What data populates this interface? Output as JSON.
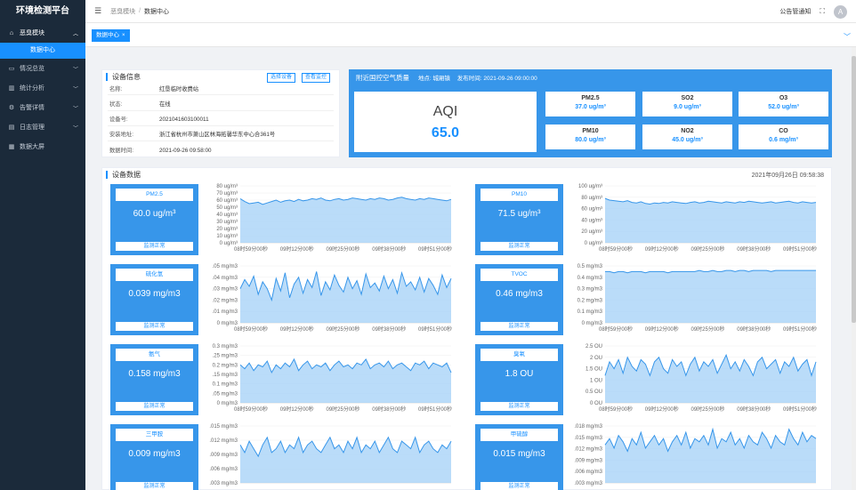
{
  "app": {
    "title": "环境检测平台"
  },
  "sidebar": {
    "items": [
      {
        "label": "恶臭模块",
        "icon": "home-icon",
        "glyph": "⌂",
        "open": true
      },
      {
        "label": "情况总览",
        "icon": "monitor-icon",
        "glyph": "▭"
      },
      {
        "label": "统计分析",
        "icon": "bar-chart-icon",
        "glyph": "▥"
      },
      {
        "label": "告警详情",
        "icon": "bell-icon",
        "glyph": "⚙"
      },
      {
        "label": "日志管理",
        "icon": "document-icon",
        "glyph": "▤"
      },
      {
        "label": "数据大屏",
        "icon": "screen-icon",
        "glyph": "▦"
      }
    ],
    "sub_item": "数据中心"
  },
  "header": {
    "breadcrumb": [
      "恶臭模块",
      "数据中心"
    ],
    "notice": "公告管通知",
    "fullscreen_glyph": "⛶",
    "avatar_glyph": "A"
  },
  "tabs": [
    {
      "label": "数据中心"
    }
  ],
  "device_info": {
    "title": "设备信息",
    "btn_select": "选择设备",
    "btn_monitor": "查看监控",
    "rows": [
      {
        "label": "名称:",
        "value": "红垦临时收费站"
      },
      {
        "label": "状态:",
        "value": "在线"
      },
      {
        "label": "设备号:",
        "value": "2021041603100011"
      },
      {
        "label": "安装地址:",
        "value": "浙江省杭州市萧山区林海拓馨华东中心合361号"
      },
      {
        "label": "数据时间:",
        "value": "2021-09-26 09:58:00"
      }
    ]
  },
  "aqi": {
    "title": "附近国控空气质量",
    "station": "地点: 城厢镇",
    "publish": "发布时间: 2021-09-26 09:00:00",
    "label": "AQI",
    "value": "65.0",
    "pollutants": [
      {
        "name": "PM2.5",
        "value": "37.0 ug/m³"
      },
      {
        "name": "SO2",
        "value": "9.0 ug/m³"
      },
      {
        "name": "O3",
        "value": "52.0 ug/m³"
      },
      {
        "name": "PM10",
        "value": "80.0 ug/m³"
      },
      {
        "name": "NO2",
        "value": "45.0 ug/m³"
      },
      {
        "name": "CO",
        "value": "0.6 mg/m³"
      }
    ]
  },
  "device_data": {
    "title": "设备数据",
    "time": "2021年09月26日 09:58:38"
  },
  "chart_data": [
    {
      "type": "area",
      "name": "PM2.5",
      "reading": "60.0 ug/m³",
      "status": "监测正常",
      "yticks": [
        "80 ug/m³",
        "70 ug/m³",
        "60 ug/m³",
        "50 ug/m³",
        "40 ug/m³",
        "30 ug/m³",
        "20 ug/m³",
        "10 ug/m³",
        "0 ug/m³"
      ],
      "ymax": 80,
      "xticks": [
        "08时59分00秒",
        "09时12分00秒",
        "09时25分00秒",
        "09时38分00秒",
        "09时51分00秒"
      ],
      "values": [
        62,
        58,
        55,
        56,
        57,
        54,
        56,
        58,
        60,
        57,
        59,
        60,
        58,
        61,
        59,
        60,
        62,
        61,
        63,
        60,
        59,
        61,
        62,
        60,
        61,
        63,
        62,
        61,
        60,
        62,
        61,
        63,
        62,
        60,
        61,
        63,
        64,
        62,
        61,
        60,
        62,
        61,
        63,
        62,
        61,
        60,
        59,
        61
      ]
    },
    {
      "type": "area",
      "name": "PM10",
      "reading": "71.5 ug/m³",
      "status": "监测正常",
      "yticks": [
        "100 ug/m³",
        "80 ug/m³",
        "60 ug/m³",
        "40 ug/m³",
        "20 ug/m³",
        "0 ug/m³"
      ],
      "ymax": 100,
      "xticks": [
        "08时59分00秒",
        "09时12分00秒",
        "09时25分00秒",
        "09时38分00秒",
        "09时51分00秒"
      ],
      "values": [
        78,
        75,
        74,
        73,
        72,
        74,
        71,
        70,
        72,
        69,
        68,
        70,
        69,
        71,
        70,
        72,
        71,
        70,
        69,
        71,
        72,
        70,
        71,
        73,
        72,
        71,
        70,
        72,
        71,
        70,
        72,
        71,
        73,
        72,
        71,
        70,
        71,
        72,
        70,
        71,
        72,
        73,
        71,
        70,
        72,
        71,
        70,
        71
      ]
    },
    {
      "type": "area",
      "name": "硫化氢",
      "reading": "0.039 mg/m3",
      "status": "监测正常",
      "yticks": [
        ".05 mg/m3",
        ".04 mg/m3",
        ".03 mg/m3",
        ".02 mg/m3",
        ".01 mg/m3",
        "0 mg/m3"
      ],
      "ymax": 0.05,
      "xticks": [
        "08时59分00秒",
        "09时12分00秒",
        "09时25分00秒",
        "09时38分00秒",
        "09时51分00秒"
      ],
      "values": [
        0.03,
        0.038,
        0.032,
        0.041,
        0.025,
        0.036,
        0.03,
        0.02,
        0.039,
        0.028,
        0.044,
        0.022,
        0.034,
        0.04,
        0.026,
        0.038,
        0.031,
        0.045,
        0.024,
        0.036,
        0.029,
        0.042,
        0.033,
        0.027,
        0.04,
        0.03,
        0.037,
        0.025,
        0.043,
        0.031,
        0.035,
        0.028,
        0.041,
        0.03,
        0.038,
        0.026,
        0.044,
        0.032,
        0.036,
        0.029,
        0.04,
        0.027,
        0.039,
        0.033,
        0.025,
        0.042,
        0.031,
        0.039
      ]
    },
    {
      "type": "area",
      "name": "TVOC",
      "reading": "0.46 mg/m3",
      "status": "监测正常",
      "yticks": [
        "0.5 mg/m3",
        "0.4 mg/m3",
        "0.3 mg/m3",
        "0.2 mg/m3",
        "0.1 mg/m3",
        "0 mg/m3"
      ],
      "ymax": 0.5,
      "xticks": [
        "08时59分00秒",
        "09时12分00秒",
        "09时25分00秒",
        "09时38分00秒",
        "09时51分00秒"
      ],
      "values": [
        0.45,
        0.45,
        0.44,
        0.45,
        0.45,
        0.44,
        0.45,
        0.45,
        0.45,
        0.44,
        0.45,
        0.45,
        0.45,
        0.45,
        0.44,
        0.45,
        0.45,
        0.45,
        0.45,
        0.45,
        0.45,
        0.46,
        0.45,
        0.45,
        0.46,
        0.45,
        0.45,
        0.46,
        0.46,
        0.45,
        0.46,
        0.46,
        0.45,
        0.46,
        0.46,
        0.46,
        0.46,
        0.45,
        0.46,
        0.46,
        0.46,
        0.46,
        0.46,
        0.46,
        0.46,
        0.46,
        0.46,
        0.46
      ]
    },
    {
      "type": "area",
      "name": "氨气",
      "reading": "0.158 mg/m3",
      "status": "监测正常",
      "yticks": [
        "0.3 mg/m3",
        ".25 mg/m3",
        "0.2 mg/m3",
        ".15 mg/m3",
        "0.1 mg/m3",
        ".05 mg/m3",
        "0 mg/m3"
      ],
      "ymax": 0.3,
      "xticks": [
        "08时59分00秒",
        "09时12分00秒",
        "09时25分00秒",
        "09时38分00秒",
        "09时51分00秒"
      ],
      "values": [
        0.2,
        0.18,
        0.21,
        0.17,
        0.2,
        0.19,
        0.22,
        0.16,
        0.2,
        0.18,
        0.21,
        0.19,
        0.23,
        0.17,
        0.2,
        0.22,
        0.18,
        0.2,
        0.19,
        0.21,
        0.17,
        0.2,
        0.22,
        0.19,
        0.2,
        0.18,
        0.21,
        0.2,
        0.23,
        0.18,
        0.2,
        0.21,
        0.19,
        0.22,
        0.18,
        0.2,
        0.21,
        0.19,
        0.17,
        0.21,
        0.2,
        0.22,
        0.18,
        0.21,
        0.2,
        0.19,
        0.21,
        0.16
      ]
    },
    {
      "type": "area",
      "name": "臭氧",
      "reading": "1.8 OU",
      "status": "监测正常",
      "yticks": [
        "2.5 OU",
        "2 OU",
        "1.5 OU",
        "1 OU",
        "0.5 OU",
        "0 OU"
      ],
      "ymax": 2.5,
      "xticks": [
        "08时59分00秒",
        "09时12分00秒",
        "09时25分00秒",
        "09时38分00秒",
        "09时51分00秒"
      ],
      "values": [
        1.2,
        1.8,
        1.5,
        1.9,
        1.3,
        2.0,
        1.6,
        1.4,
        1.9,
        1.7,
        1.2,
        1.8,
        2.0,
        1.5,
        1.3,
        1.9,
        1.6,
        1.8,
        1.2,
        1.7,
        2.0,
        1.4,
        1.8,
        1.6,
        1.9,
        1.3,
        1.7,
        2.1,
        1.5,
        1.8,
        1.4,
        1.9,
        1.6,
        1.2,
        1.8,
        2.0,
        1.5,
        1.7,
        1.9,
        1.3,
        1.8,
        1.6,
        2.0,
        1.4,
        1.7,
        1.9,
        1.2,
        1.8
      ]
    },
    {
      "type": "area",
      "name": "三甲胺",
      "reading": "0.009 mg/m3",
      "status": "监测正常",
      "yticks": [
        ".015 mg/m3",
        ".012 mg/m3",
        ".009 mg/m3",
        ".006 mg/m3",
        ".003 mg/m3"
      ],
      "ymax": 0.015,
      "xticks": [],
      "values": [
        0.01,
        0.008,
        0.011,
        0.009,
        0.007,
        0.01,
        0.012,
        0.008,
        0.009,
        0.011,
        0.008,
        0.01,
        0.009,
        0.012,
        0.008,
        0.01,
        0.011,
        0.009,
        0.008,
        0.01,
        0.012,
        0.009,
        0.01,
        0.008,
        0.011,
        0.009,
        0.012,
        0.008,
        0.01,
        0.009,
        0.011,
        0.008,
        0.01,
        0.012,
        0.009,
        0.008,
        0.011,
        0.01,
        0.009,
        0.012,
        0.008,
        0.01,
        0.011,
        0.009,
        0.008,
        0.01,
        0.009,
        0.011
      ]
    },
    {
      "type": "area",
      "name": "甲硫醇",
      "reading": "0.015 mg/m3",
      "status": "监测正常",
      "yticks": [
        ".018 mg/m3",
        ".015 mg/m3",
        ".012 mg/m3",
        ".009 mg/m3",
        ".006 mg/m3",
        ".003 mg/m3"
      ],
      "ymax": 0.018,
      "xticks": [],
      "values": [
        0.012,
        0.014,
        0.011,
        0.015,
        0.013,
        0.01,
        0.014,
        0.012,
        0.016,
        0.011,
        0.013,
        0.015,
        0.012,
        0.014,
        0.01,
        0.013,
        0.015,
        0.012,
        0.016,
        0.011,
        0.014,
        0.013,
        0.015,
        0.012,
        0.017,
        0.011,
        0.014,
        0.013,
        0.016,
        0.012,
        0.014,
        0.011,
        0.015,
        0.013,
        0.012,
        0.016,
        0.014,
        0.011,
        0.015,
        0.013,
        0.012,
        0.017,
        0.014,
        0.012,
        0.016,
        0.013,
        0.015,
        0.014
      ]
    }
  ]
}
